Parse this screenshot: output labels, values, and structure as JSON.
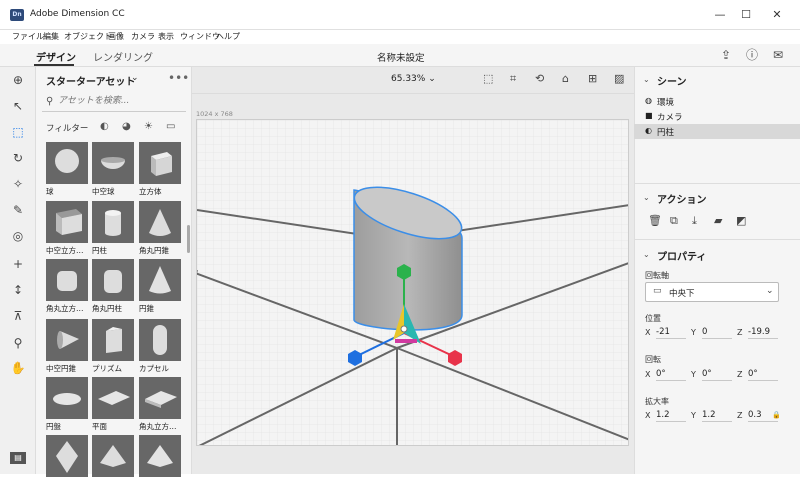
{
  "window": {
    "app_title": "Adobe Dimension CC",
    "logo_text": "Dn",
    "minimize": "—",
    "maximize": "☐",
    "close": "✕"
  },
  "menu": [
    "ファイル",
    "編集",
    "オブジェクト",
    "画像",
    "カメラ",
    "表示",
    "ウィンドウ",
    "ヘルプ"
  ],
  "header": {
    "tabs": [
      "デザイン",
      "レンダリング"
    ],
    "document_title": "名称未設定",
    "share_icon": "share-icon",
    "help_icon": "help-icon",
    "feedback_icon": "feedback-icon"
  },
  "assets": {
    "title": "スターターアセット",
    "search_placeholder": "アセットを検索...",
    "filter_label": "フィルター",
    "items": [
      {
        "label": "球",
        "shape": "sphere"
      },
      {
        "label": "中空球",
        "shape": "hollow-sphere"
      },
      {
        "label": "立方体",
        "shape": "cube"
      },
      {
        "label": "中空立方…",
        "shape": "hollow-cube"
      },
      {
        "label": "円柱",
        "shape": "cylinder"
      },
      {
        "label": "角丸円錐",
        "shape": "rounded-cone"
      },
      {
        "label": "角丸立方…",
        "shape": "rounded-cube"
      },
      {
        "label": "角丸円柱",
        "shape": "rounded-cylinder"
      },
      {
        "label": "円錐",
        "shape": "cone"
      },
      {
        "label": "中空円錐",
        "shape": "hollow-cone"
      },
      {
        "label": "プリズム",
        "shape": "prism"
      },
      {
        "label": "カプセル",
        "shape": "capsule"
      },
      {
        "label": "円盤",
        "shape": "disc"
      },
      {
        "label": "平面",
        "shape": "plane"
      },
      {
        "label": "角丸立方…",
        "shape": "rounded-box"
      },
      {
        "label": "",
        "shape": "octahedron"
      },
      {
        "label": "",
        "shape": "pyramid"
      },
      {
        "label": "",
        "shape": "pyramid2"
      }
    ]
  },
  "viewport": {
    "zoom": "65.33%",
    "canvas_size": "1024 x 768"
  },
  "scene": {
    "title": "シーン",
    "items": [
      {
        "label": "環境",
        "icon": "globe-icon",
        "selected": false
      },
      {
        "label": "カメラ",
        "icon": "camera-icon",
        "selected": false
      },
      {
        "label": "円柱",
        "icon": "object-icon",
        "selected": true
      }
    ]
  },
  "actions": {
    "title": "アクション"
  },
  "properties": {
    "title": "プロパティ",
    "pivot_label": "回転軸",
    "pivot_value": "中央下",
    "position_label": "位置",
    "position": {
      "x": "-21",
      "y": "0",
      "z": "-19.9"
    },
    "rotation_label": "回転",
    "rotation": {
      "x": "0°",
      "y": "0°",
      "z": "0°"
    },
    "scale_label": "拡大率",
    "scale": {
      "x": "1.2",
      "y": "1.2",
      "z": "0.3"
    },
    "axis_x": "X",
    "axis_y": "Y",
    "axis_z": "Z"
  },
  "colors": {
    "accent": "#1473e6",
    "gizmo_x": "#e8334a",
    "gizmo_y": "#2bb24c",
    "gizmo_z": "#1e6fe0"
  }
}
